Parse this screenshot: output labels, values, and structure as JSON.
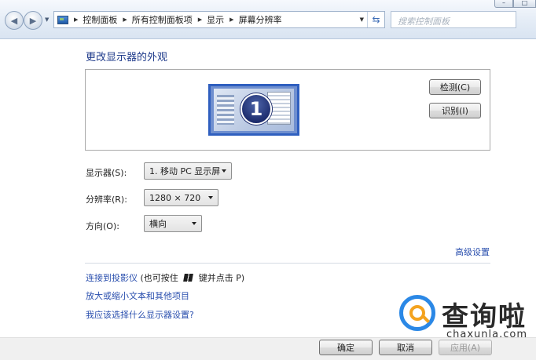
{
  "nav": {
    "breadcrumbs": [
      "控制面板",
      "所有控制面板项",
      "显示",
      "屏幕分辨率"
    ],
    "search_placeholder": "搜索控制面板"
  },
  "page": {
    "title": "更改显示器的外观",
    "monitor_number": "1",
    "detect_label": "检测(C)",
    "identify_label": "识别(I)"
  },
  "settings": {
    "display_label": "显示器(S):",
    "display_value": "1. 移动 PC 显示屏",
    "resolution_label": "分辨率(R):",
    "resolution_value": "1280 × 720",
    "orientation_label": "方向(O):",
    "orientation_value": "横向"
  },
  "links": {
    "advanced": "高级设置",
    "projector_link": "连接到投影仪",
    "projector_hint_pre": "(也可按住",
    "projector_hint_post": "键并点击 P)",
    "enlarge": "放大或缩小文本和其他项目",
    "which_settings": "我应该选择什么显示器设置?"
  },
  "footer": {
    "ok_label": "确定",
    "cancel_label": "取消",
    "apply_label": "应用(A)"
  },
  "watermark": {
    "text_cn": "查询啦",
    "text_en": "chaxunla.com"
  },
  "colors": {
    "link": "#2a4fae",
    "title": "#1e3a8a",
    "monitor_border": "#2f5fbf"
  }
}
